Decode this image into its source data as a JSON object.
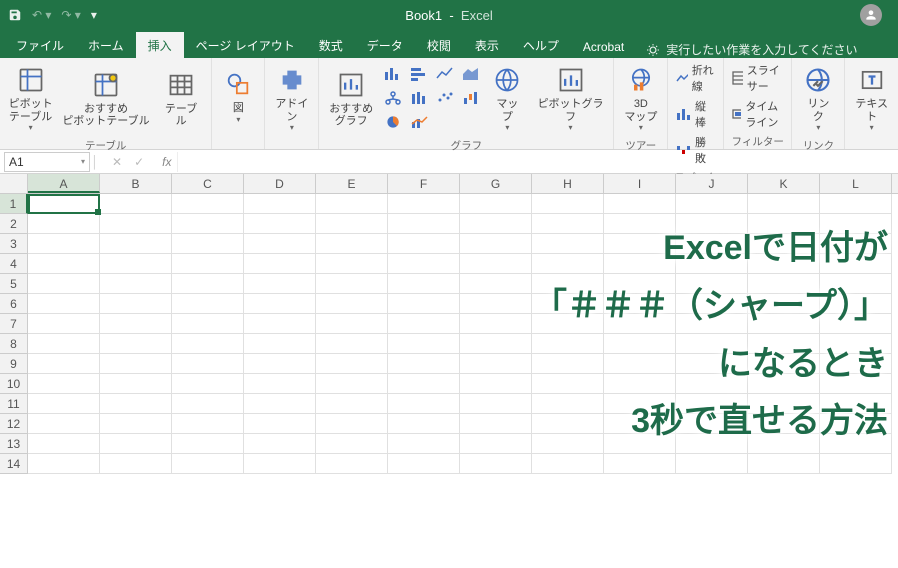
{
  "title": {
    "book": "Book1",
    "app": "Excel"
  },
  "tabs": [
    "ファイル",
    "ホーム",
    "挿入",
    "ページ レイアウト",
    "数式",
    "データ",
    "校閲",
    "表示",
    "ヘルプ",
    "Acrobat"
  ],
  "active_tab": 2,
  "tell_me": "実行したい作業を入力してください",
  "ribbon": {
    "g0": {
      "label": "テーブル",
      "btns": [
        "ピボット\nテーブル",
        "おすすめ\nピボットテーブル",
        "テーブル"
      ]
    },
    "g1": {
      "label": "",
      "btns": [
        "図"
      ]
    },
    "g2": {
      "label": "",
      "btns": [
        "アドイ\nン"
      ]
    },
    "g3": {
      "label": "グラフ",
      "btns": [
        "おすすめ\nグラフ",
        "マップ",
        "ピボットグラ\nフ"
      ]
    },
    "g4": {
      "label": "ツアー",
      "btns": [
        "3D\nマップ"
      ]
    },
    "g5": {
      "label": "スパークライン",
      "items": [
        "折れ線",
        "縦棒",
        "勝敗"
      ]
    },
    "g6": {
      "label": "フィルター",
      "items": [
        "スライサー",
        "タイムライン"
      ]
    },
    "g7": {
      "label": "リンク",
      "btns": [
        "リン\nク"
      ]
    },
    "g8": {
      "label": "",
      "btns": [
        "テキス\nト"
      ]
    }
  },
  "namebox": "A1",
  "columns": [
    "A",
    "B",
    "C",
    "D",
    "E",
    "F",
    "G",
    "H",
    "I",
    "J",
    "K",
    "L"
  ],
  "rows": 14,
  "overlay_lines": [
    "Excelで日付が",
    "「＃＃＃（シャープ）」",
    "になるとき",
    "3秒で直せる方法"
  ]
}
